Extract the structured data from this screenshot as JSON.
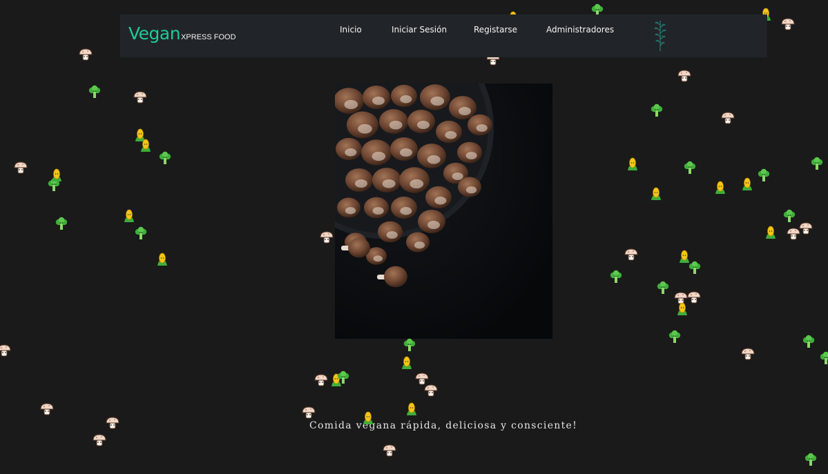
{
  "navbar": {
    "brand_main": "Vegan",
    "brand_sub": "XPRESS FOOD",
    "links": [
      "Inicio",
      "Iniciar Sesión",
      "Registarse",
      "Administradores"
    ],
    "logo_icon": "herb-icon"
  },
  "hero": {
    "image": "mushrooms-bowl-photo",
    "tagline": "Comida vegana rápida, deliciosa y consciente!"
  },
  "decor": {
    "sprite_icons": [
      "mushroom-icon",
      "broccoli-icon",
      "corn-icon"
    ]
  },
  "colors": {
    "background": "#1a1a1a",
    "navbar": "#212529",
    "brand": "#20c997",
    "text": "#f5f5f5"
  }
}
